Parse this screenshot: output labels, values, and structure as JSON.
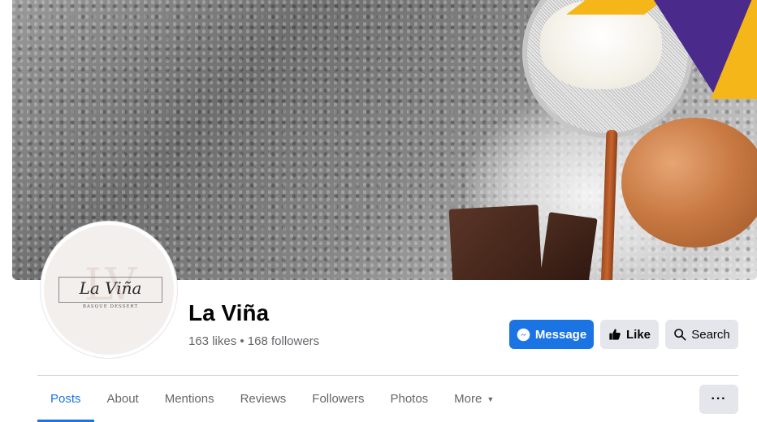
{
  "cover": {
    "accent_yellow": "#f5b61a",
    "accent_purple": "#4a2b8c"
  },
  "avatar": {
    "monogram": "LV",
    "logo_script": "La Viña",
    "logo_sub": "BASQUE DESSERT"
  },
  "page": {
    "name": "La Viña",
    "stats": "163 likes • 168 followers"
  },
  "actions": {
    "message_label": "Message",
    "like_label": "Like",
    "search_label": "Search",
    "primary_color": "#1b74e4"
  },
  "tabs": [
    {
      "label": "Posts",
      "active": true
    },
    {
      "label": "About"
    },
    {
      "label": "Mentions"
    },
    {
      "label": "Reviews"
    },
    {
      "label": "Followers"
    },
    {
      "label": "Photos"
    },
    {
      "label": "More",
      "icon": "caret-down-icon"
    }
  ],
  "overflow": {
    "label": "···",
    "icon": "more-options-icon"
  }
}
